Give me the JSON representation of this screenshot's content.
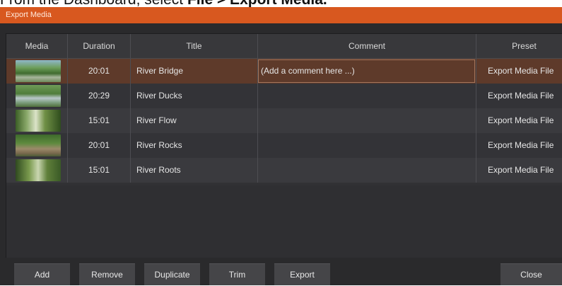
{
  "instruction": {
    "prefix": "From the Dashboard, select ",
    "menu_path": "File > Export Media."
  },
  "window": {
    "title": "Export Media"
  },
  "table": {
    "columns": [
      "Media",
      "Duration",
      "Title",
      "Comment",
      "Preset"
    ],
    "rows": [
      {
        "duration": "20:01",
        "title": "River Bridge",
        "comment": "(Add a comment here ...)",
        "preset": "Export Media File",
        "selected": true
      },
      {
        "duration": "20:29",
        "title": "River Ducks",
        "comment": "",
        "preset": "Export Media File",
        "selected": false
      },
      {
        "duration": "15:01",
        "title": "River Flow",
        "comment": "",
        "preset": "Export Media File",
        "selected": false
      },
      {
        "duration": "20:01",
        "title": "River Rocks",
        "comment": "",
        "preset": "Export Media File",
        "selected": false
      },
      {
        "duration": "15:01",
        "title": "River Roots",
        "comment": "",
        "preset": "Export Media File",
        "selected": false
      }
    ]
  },
  "buttons": {
    "add": "Add",
    "remove": "Remove",
    "duplicate": "Duplicate",
    "trim": "Trim",
    "export": "Export",
    "close": "Close"
  },
  "colors": {
    "titlebar": "#d8581f",
    "selected_row": "#5e3a2a",
    "background": "#2a2a2c"
  },
  "icons": {
    "preset_dropdown": "chevron-down-icon",
    "thumbnails": "video-thumbnail"
  }
}
